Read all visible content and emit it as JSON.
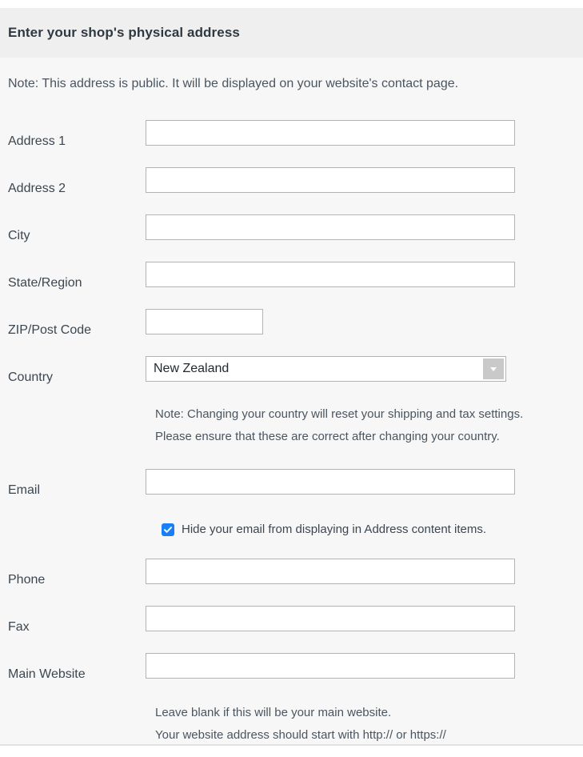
{
  "panel": {
    "title": "Enter your shop's physical address",
    "top_note": "Note: This address is public. It will be displayed on your website's contact page."
  },
  "fields": {
    "address1": {
      "label": "Address 1",
      "value": "",
      "placeholder": ""
    },
    "address2": {
      "label": "Address 2",
      "value": "",
      "placeholder": ""
    },
    "city": {
      "label": "City",
      "value": "",
      "placeholder": ""
    },
    "state": {
      "label": "State/Region",
      "value": "",
      "placeholder": ""
    },
    "zip": {
      "label": "ZIP/Post Code",
      "value": "",
      "placeholder": ""
    },
    "country": {
      "label": "Country",
      "value": "New Zealand",
      "note_line1": "Note: Changing your country will reset your shipping and tax settings.",
      "note_line2": "Please ensure that these are correct after changing your country."
    },
    "email": {
      "label": "Email",
      "value": "",
      "placeholder": ""
    },
    "hide_email": {
      "label": "Hide your email from displaying in Address content items.",
      "checked": true
    },
    "phone": {
      "label": "Phone",
      "value": "",
      "placeholder": ""
    },
    "fax": {
      "label": "Fax",
      "value": "",
      "placeholder": ""
    },
    "website": {
      "label": "Main Website",
      "value": "",
      "placeholder": "",
      "note_line1": "Leave blank if this will be your main website.",
      "note_line2": "Your website address should start with http:// or https://"
    }
  },
  "icons": {
    "dropdown": "chevron-down-icon",
    "check": "checkmark-icon"
  },
  "colors": {
    "header_band": "#efefef",
    "body_bg": "#f7f7f7",
    "checkbox_blue": "#1a7ef5",
    "input_border": "#b4b4b4",
    "label_text": "#3c4651"
  }
}
